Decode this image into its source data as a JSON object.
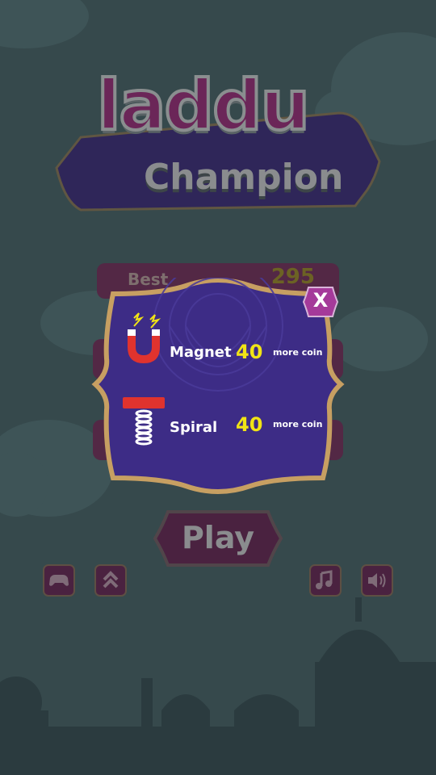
{
  "title": {
    "line1": "laddu",
    "line2": "Champion"
  },
  "stats": [
    {
      "label": "Best",
      "value": "295"
    }
  ],
  "play_label": "Play",
  "modal": {
    "close_label": "X",
    "items": [
      {
        "name": "Magnet",
        "count": "40",
        "unit": "more coin",
        "icon": "magnet-icon"
      },
      {
        "name": "Spiral",
        "count": "40",
        "unit": "more coin",
        "icon": "spring-icon"
      }
    ]
  },
  "bottom_buttons": [
    "gamepad-icon",
    "double-chevron-up-icon",
    "music-note-icon",
    "speaker-icon"
  ],
  "colors": {
    "background": "#36494c",
    "panel_purple": "#3d2c86",
    "gold_border": "#c79f62",
    "count_yellow": "#f1e415",
    "close_pink": "#a53a9a"
  }
}
